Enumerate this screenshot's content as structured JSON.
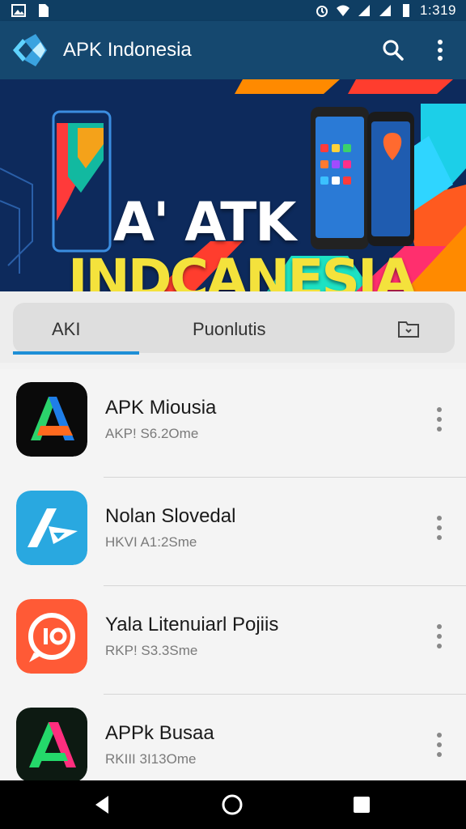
{
  "status_bar": {
    "time": "1:319",
    "icons": [
      "image-icon",
      "sim-icon",
      "alarm-icon",
      "wifi-icon",
      "signal-icon",
      "signal-icon",
      "battery-icon"
    ]
  },
  "app_bar": {
    "title": "APK Indonesia",
    "actions": [
      "search-icon",
      "more-vert-icon"
    ]
  },
  "banner": {
    "line1": "A' ATK",
    "line2": "INDCANESIA"
  },
  "tabs": [
    {
      "label": "AKI",
      "selected": true
    },
    {
      "label": "Puonlutis",
      "selected": false
    }
  ],
  "apps": [
    {
      "name": "APK Miousia",
      "meta": "AKP! S6.2Ome",
      "icon": "letter-a-icon"
    },
    {
      "name": "Nolan Slovedal",
      "meta": "HKVI A1:2Sme",
      "icon": "paper-plane-a-icon"
    },
    {
      "name": "Yala Litenuiarl Pojiis",
      "meta": "RKP! S3.3Sme",
      "icon": "chat-io-icon"
    },
    {
      "name": "APPk Busaa",
      "meta": "RKIII 3I13Ome",
      "icon": "letter-a-icon"
    }
  ],
  "colors": {
    "app_bar": "#15486f",
    "tab_indicator": "#1e8fd6",
    "banner_yellow": "#f4e23c"
  },
  "nav_bar": [
    "back-icon",
    "home-icon",
    "recents-icon"
  ]
}
